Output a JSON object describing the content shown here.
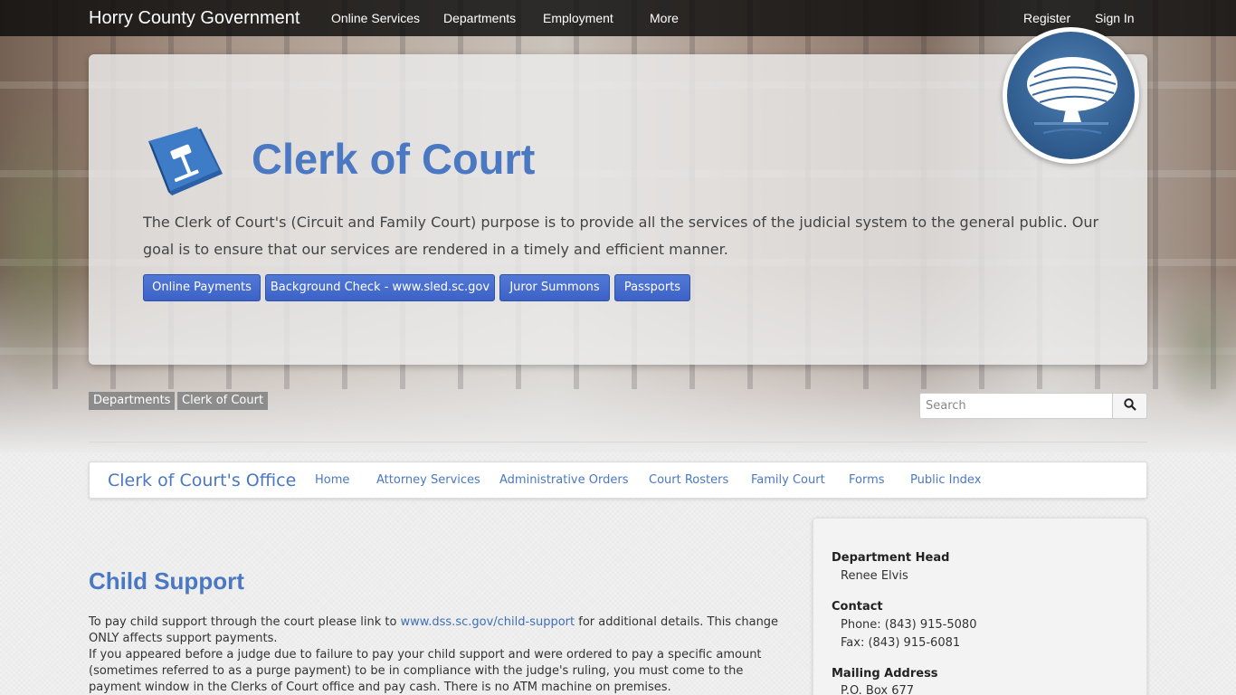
{
  "topbar": {
    "site_title": "Horry County Government",
    "nav": [
      "Online Services",
      "Departments",
      "Employment",
      "More"
    ],
    "register": "Register",
    "sign_in": "Sign In"
  },
  "hero": {
    "title": "Clerk of Court",
    "description": "The Clerk of Court's (Circuit and Family Court) purpose is to provide all the services of the judicial system to the general public. Our goal is to ensure that our services are rendered in a timely and efficient manner.",
    "buttons": [
      "Online Payments",
      "Background Check - www.sled.sc.gov",
      "Juror Summons",
      "Passports"
    ]
  },
  "breadcrumb": [
    "Departments",
    "Clerk of Court"
  ],
  "search": {
    "placeholder": "Search"
  },
  "subnav": {
    "brand": "Clerk of Court's Office",
    "links": [
      "Home",
      "Attorney Services",
      "Administrative Orders",
      "Court Rosters",
      "Family Court",
      "Forms",
      "Public Index"
    ]
  },
  "content": {
    "title": "Child Support",
    "p1_before": "To pay child support through the court please link to ",
    "p1_link": "www.dss.sc.gov/child-support",
    "p1_after": " for additional details. This change ONLY affects support payments.",
    "p2": "If you appeared before a judge due to failure to pay your child support and were ordered to pay a specific amount (sometimes referred to as a purge payment) to be in compliance with the judge's ruling, you must come to the payment window in the Clerks of Court office and pay cash.  There is no ATM machine on premises."
  },
  "sidebar": {
    "head_label": "Department Head",
    "head_value": "Renee Elvis",
    "contact_label": "Contact",
    "phone": "Phone: (843) 915-5080",
    "fax": "Fax: (843) 915-6081",
    "mailing_label": "Mailing Address",
    "po_box": "P.O. Box 677"
  },
  "colors": {
    "accent": "#4a78c2",
    "button": "#4069cc",
    "topbar": "#0a0a0a"
  }
}
